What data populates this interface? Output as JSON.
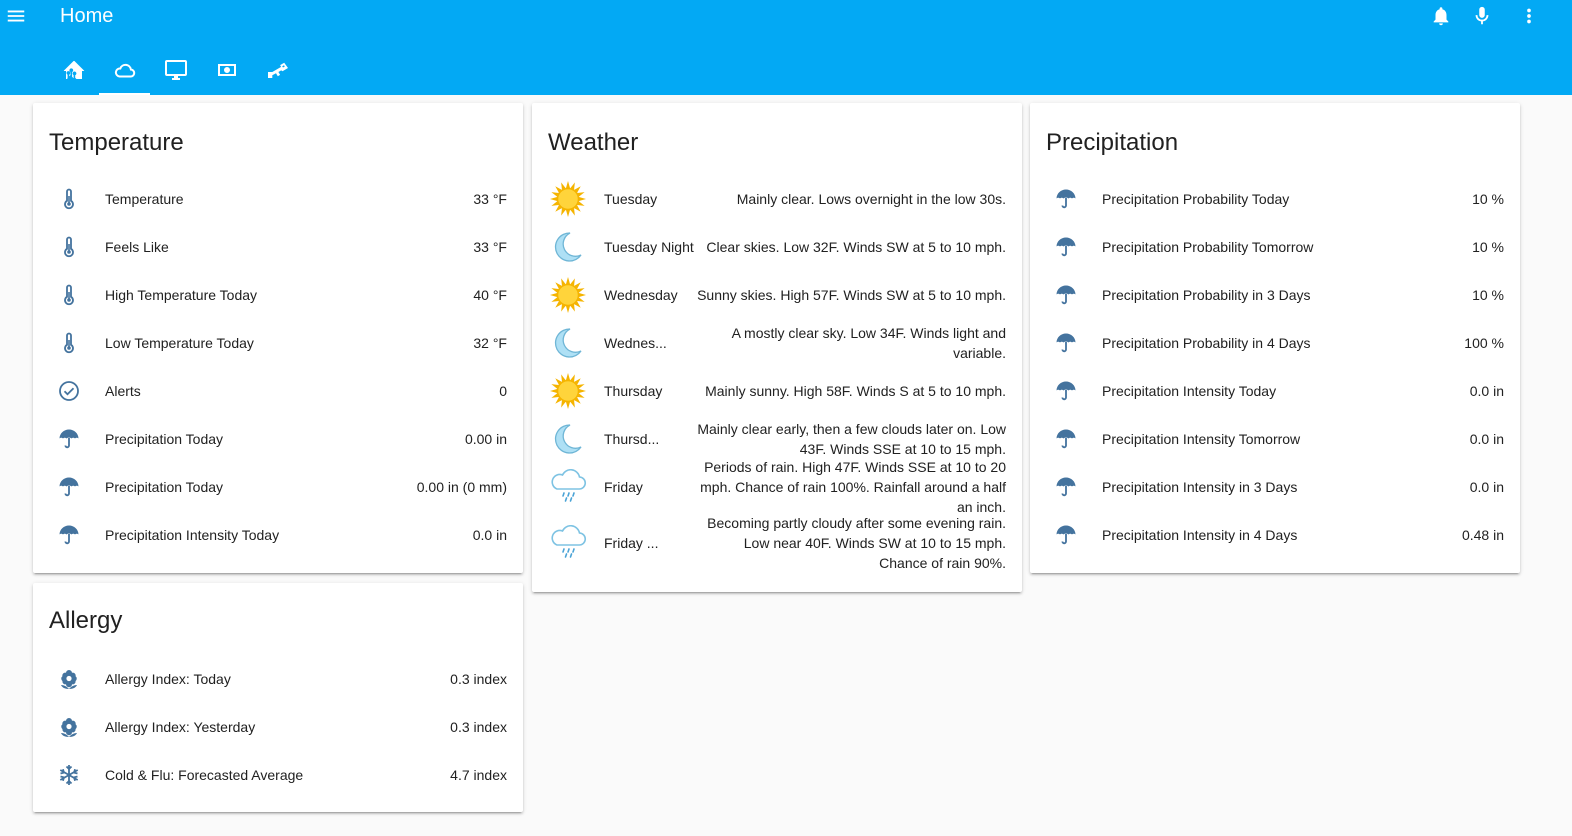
{
  "header": {
    "title": "Home",
    "tabs": [
      {
        "icon": "home-assistant-icon"
      },
      {
        "icon": "cloud-icon",
        "active": true
      },
      {
        "icon": "monitor-icon"
      },
      {
        "icon": "cash-icon"
      },
      {
        "icon": "cctv-icon"
      }
    ],
    "actions": [
      "bell-icon",
      "microphone-icon",
      "more-vertical-icon"
    ]
  },
  "temperature": {
    "title": "Temperature",
    "rows": [
      {
        "icon": "thermometer-icon",
        "label": "Temperature",
        "value": "33 °F"
      },
      {
        "icon": "thermometer-icon",
        "label": "Feels Like",
        "value": "33 °F"
      },
      {
        "icon": "thermometer-icon",
        "label": "High Temperature Today",
        "value": "40 °F"
      },
      {
        "icon": "thermometer-icon",
        "label": "Low Temperature Today",
        "value": "32 °F"
      },
      {
        "icon": "check-circle-icon",
        "label": "Alerts",
        "value": "0"
      },
      {
        "icon": "umbrella-icon",
        "label": "Precipitation Today",
        "value": "0.00 in"
      },
      {
        "icon": "umbrella-icon",
        "label": "Precipitation Today",
        "value": "0.00 in (0 mm)"
      },
      {
        "icon": "umbrella-icon",
        "label": "Precipitation Intensity Today",
        "value": "0.0 in"
      }
    ]
  },
  "allergy": {
    "title": "Allergy",
    "rows": [
      {
        "icon": "flower-icon",
        "label": "Allergy Index: Today",
        "value": "0.3 index"
      },
      {
        "icon": "flower-icon",
        "label": "Allergy Index: Yesterday",
        "value": "0.3 index"
      },
      {
        "icon": "snowflake-icon",
        "label": "Cold & Flu: Forecasted Average",
        "value": "4.7 index"
      }
    ]
  },
  "weather": {
    "title": "Weather",
    "rows": [
      {
        "icon": "sun-icon",
        "label": "Tuesday",
        "value": "Mainly clear. Lows overnight in the low 30s."
      },
      {
        "icon": "moon-icon",
        "label": "Tuesday Night",
        "value": "Clear skies. Low 32F. Winds SW at 5 to 10 mph."
      },
      {
        "icon": "sun-icon",
        "label": "Wednesday",
        "value": "Sunny skies. High 57F. Winds SW at 5 to 10 mph."
      },
      {
        "icon": "moon-icon",
        "label": "Wednes...",
        "value": "A mostly clear sky. Low 34F. Winds light and variable."
      },
      {
        "icon": "sun-icon",
        "label": "Thursday",
        "value": "Mainly sunny. High 58F. Winds S at 5 to 10 mph."
      },
      {
        "icon": "moon-icon",
        "label": "Thursd...",
        "value": "Mainly clear early, then a few clouds later on. Low 43F. Winds SSE at 10 to 15 mph."
      },
      {
        "icon": "rain-cloud-icon",
        "label": "Friday",
        "value": "Periods of rain. High 47F. Winds SSE at 10 to 20 mph. Chance of rain 100%. Rainfall around a half an inch."
      },
      {
        "icon": "rain-cloud-icon",
        "label": "Friday ...",
        "value": "Becoming partly cloudy after some evening rain. Low near 40F. Winds SW at 10 to 15 mph. Chance of rain 90%."
      }
    ]
  },
  "precipitation": {
    "title": "Precipitation",
    "rows": [
      {
        "icon": "umbrella-icon",
        "label": "Precipitation Probability Today",
        "value": "10 %"
      },
      {
        "icon": "umbrella-icon",
        "label": "Precipitation Probability Tomorrow",
        "value": "10 %"
      },
      {
        "icon": "umbrella-icon",
        "label": "Precipitation Probability in 3 Days",
        "value": "10 %"
      },
      {
        "icon": "umbrella-icon",
        "label": "Precipitation Probability in 4 Days",
        "value": "100 %"
      },
      {
        "icon": "umbrella-icon",
        "label": "Precipitation Intensity Today",
        "value": "0.0 in"
      },
      {
        "icon": "umbrella-icon",
        "label": "Precipitation Intensity Tomorrow",
        "value": "0.0 in"
      },
      {
        "icon": "umbrella-icon",
        "label": "Precipitation Intensity in 3 Days",
        "value": "0.0 in"
      },
      {
        "icon": "umbrella-icon",
        "label": "Precipitation Intensity in 4 Days",
        "value": "0.48 in"
      }
    ]
  },
  "colors": {
    "header": "#03a9f4",
    "icon": "#44739e",
    "background": "#fafafa",
    "sun": "#f5b400",
    "moon": "#aee0f5"
  }
}
